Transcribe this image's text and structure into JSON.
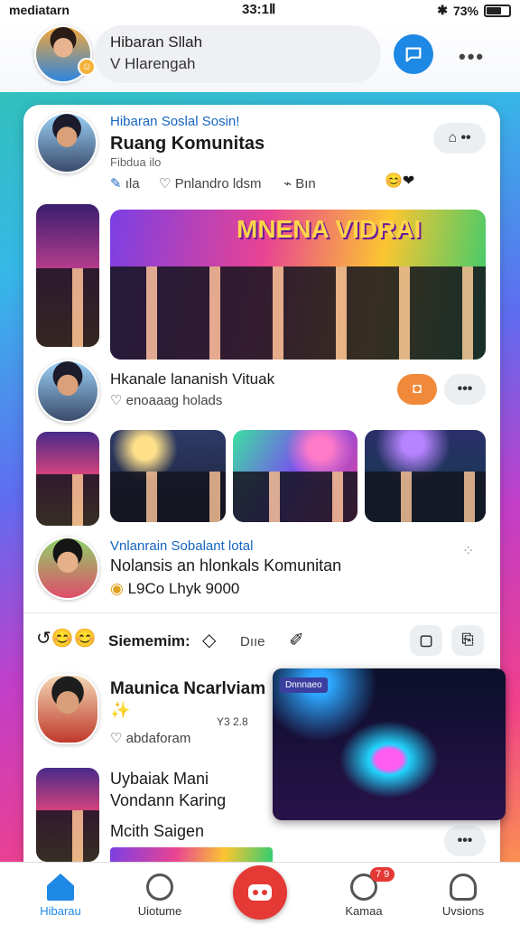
{
  "status_bar": {
    "carrier": "mediatarn",
    "time": "33:1Ⅱ",
    "battery": "73%"
  },
  "header": {
    "line1": "Hibaran Sllah",
    "line2": "V Hlarengah"
  },
  "post1": {
    "meta": "Hibaran Soslal Sosin!",
    "title": "Ruang Komunitas",
    "sub": "Fibdua ilo",
    "action1": "ıla",
    "action2": "Pnlandro ldsm",
    "action3": "Bın",
    "hero_text": "MNENA VIDRAI"
  },
  "post2": {
    "title": "Hkanale lananish Vituak",
    "sub": "enoaaag holads"
  },
  "post3": {
    "meta": "Vnlanrain Sobalant lotal",
    "title": "Nolansis an hlonkals Komunitan",
    "count": "L9Co Lhyk 9000"
  },
  "reactions": {
    "label": "Siememim:",
    "option": "Dııe"
  },
  "post4": {
    "title": "Maunica Ncarlviam",
    "sub": "abdaforam",
    "time": "Y3 2.8"
  },
  "post5": {
    "line1": "Uybaiak Mani",
    "line2": "Vondann Karing",
    "line3": "Mcith Saigen"
  },
  "pip": {
    "tag": "Dnnnaeo"
  },
  "nav": {
    "tab1": "Hibarau",
    "tab2": "Uiotume",
    "tab4": "Kamaa",
    "tab5": "Uvsions",
    "badge": "7 9"
  }
}
